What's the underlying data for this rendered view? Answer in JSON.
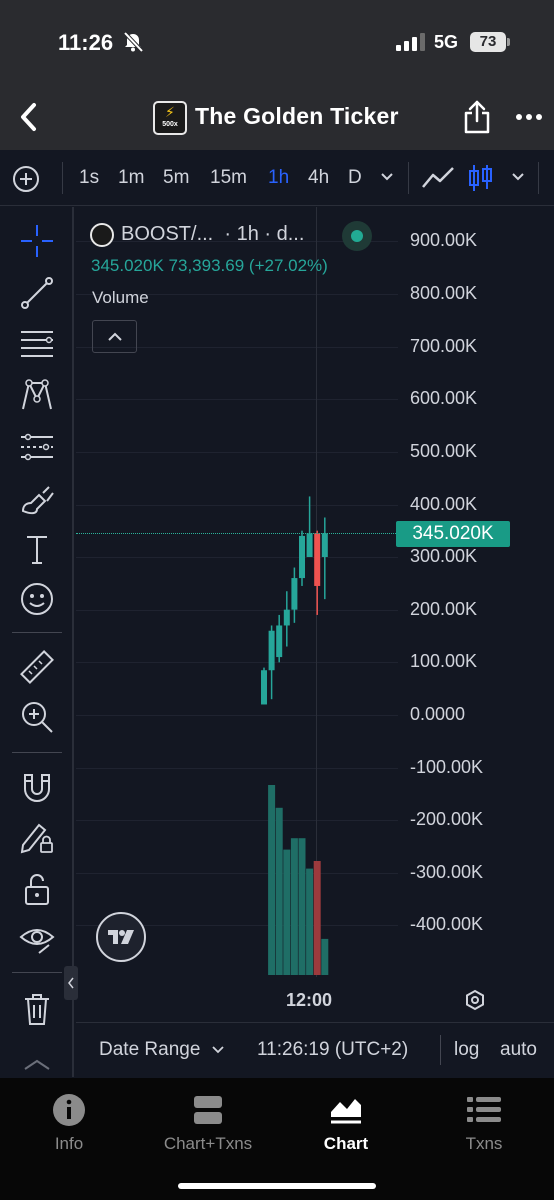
{
  "status": {
    "time": "11:26",
    "network": "5G",
    "battery": "73"
  },
  "header": {
    "title": "The Golden Ticker",
    "logo_text": "500x"
  },
  "timeframes": {
    "items": [
      "1s",
      "1m",
      "5m",
      "15m",
      "1h",
      "4h",
      "D"
    ],
    "active": "1h"
  },
  "chart": {
    "symbol": "BOOST/...",
    "interval_text": "· 1h · d...",
    "ohlc": {
      "close": "345.020K",
      "change_abs": "73,393.69",
      "change_pct": "(+27.02%)"
    },
    "volume_label": "Volume",
    "price_label": "345.020K",
    "time_label": "12:00",
    "colors": {
      "up": "#26a69a",
      "down": "#ef5350",
      "price_line": "#199b86",
      "active": "#2962ff"
    },
    "y_tick_labels": [
      "900.00K",
      "800.00K",
      "700.00K",
      "600.00K",
      "500.00K",
      "400.00K",
      "300.00K",
      "200.00K",
      "100.00K",
      "0.0000",
      "-100.00K",
      "-200.00K",
      "-300.00K",
      "-400.00K"
    ]
  },
  "chart_data": {
    "type": "candlestick",
    "title": "BOOST/... · 1h",
    "xlabel": "",
    "ylabel": "",
    "ylim": [
      -450000,
      950000
    ],
    "grid": true,
    "last_price": 345020,
    "candles": [
      {
        "o": 20000,
        "h": 90000,
        "l": 20000,
        "c": 85000
      },
      {
        "o": 85000,
        "h": 170000,
        "l": 30000,
        "c": 160000
      },
      {
        "o": 110000,
        "h": 190000,
        "l": 100000,
        "c": 170000
      },
      {
        "o": 170000,
        "h": 235000,
        "l": 130000,
        "c": 200000
      },
      {
        "o": 200000,
        "h": 280000,
        "l": 175000,
        "c": 260000
      },
      {
        "o": 260000,
        "h": 350000,
        "l": 245000,
        "c": 340000
      },
      {
        "o": 300000,
        "h": 415000,
        "l": 300000,
        "c": 345000
      },
      {
        "o": 345000,
        "h": 350000,
        "l": 190000,
        "c": 245000
      },
      {
        "o": 300000,
        "h": 375000,
        "l": 220000,
        "c": 345020
      }
    ],
    "volume_relative": [
      0,
      1.0,
      0.88,
      0.66,
      0.72,
      0.72,
      0.56,
      0.6,
      0.19
    ],
    "volume_colors": [
      "up",
      "up",
      "up",
      "up",
      "up",
      "up",
      "up",
      "down",
      "up"
    ]
  },
  "infobar": {
    "date_range": "Date Range",
    "time": "11:26:19 (UTC+2)",
    "log": "log",
    "auto": "auto"
  },
  "tabs": [
    {
      "label": "Info",
      "icon": "info-icon"
    },
    {
      "label": "Chart+Txns",
      "icon": "split-view-icon"
    },
    {
      "label": "Chart",
      "icon": "chart-icon"
    },
    {
      "label": "Txns",
      "icon": "list-icon"
    }
  ],
  "active_tab": "Chart"
}
